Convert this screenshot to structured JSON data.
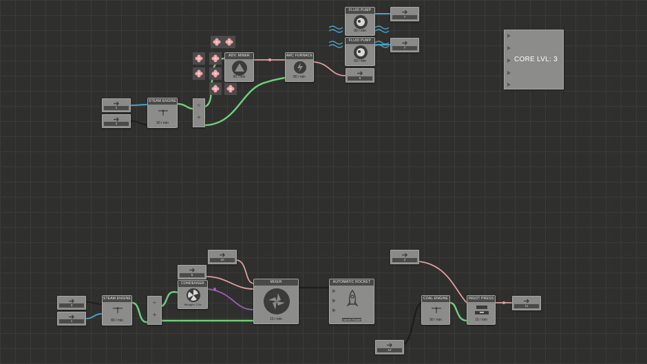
{
  "canvas": {
    "grid": true
  },
  "colors": {
    "wire_green": "#6fd07a",
    "wire_pink": "#e0a0a0",
    "wire_blue": "#4aa3c8",
    "wire_purple": "#a060c0",
    "wire_dark": "#1e1e1e"
  },
  "nodes": {
    "steam_engine_top": {
      "title": "STEAM ENGINE",
      "rate": "90 / min"
    },
    "advminer": {
      "title": "ADV. MINER",
      "rate": "90 / min"
    },
    "arc_furnace": {
      "title": "ARC FURNACE",
      "rate": "80 / min"
    },
    "fluid_pump_1": {
      "title": "FLUID PUMP",
      "rate": "90 / min"
    },
    "fluid_pump_2": {
      "title": "FLUID PUMP",
      "rate": "90 / min"
    },
    "steam_engine_bottom": {
      "title": "STEAM ENGINE",
      "rate": "80 / min"
    },
    "condenser": {
      "title": "CONDENSER",
      "rate": "Nitrogen: 2.5x"
    },
    "mixer": {
      "title": "MIXER",
      "rate": "15 / min"
    },
    "automatic_rocket": {
      "title": "AUTOMATIC ROCKET",
      "rate": "Launch Rocket"
    },
    "coal_engine": {
      "title": "COAL ENGINE",
      "rate": "90 / min"
    },
    "ingot_press": {
      "title": "INGOT PRESS",
      "rate": "15 / min"
    }
  },
  "io": {
    "top_in_1": {
      "value": "1"
    },
    "top_in_2": {
      "value": "2"
    },
    "pump_out_1": {
      "value": "7"
    },
    "pump_out_2": {
      "value": "7"
    },
    "arc_out": {
      "value": "5"
    },
    "bot_in_1": {
      "value": "3"
    },
    "bot_in_2": {
      "value": "1"
    },
    "cond_in": {
      "value": "6"
    },
    "mixer_in": {
      "value": "10"
    },
    "coal_in_top": {
      "value": "3"
    },
    "coal_in_bot": {
      "value": "12"
    },
    "ingot_out": {
      "value": "11"
    }
  },
  "core": {
    "label": "CORE LVL: 3"
  },
  "icons": {
    "arrow": "right-arrow-icon",
    "advminer": "triangle-icon",
    "arc_furnace": "lightning-icon",
    "pump": "pump-icon",
    "steam": "valve-icon",
    "mixer": "mixer-blade-icon",
    "rocket": "rocket-icon",
    "condenser": "fan-icon",
    "flower": "flower-icon",
    "water": "water-wave-icon"
  }
}
